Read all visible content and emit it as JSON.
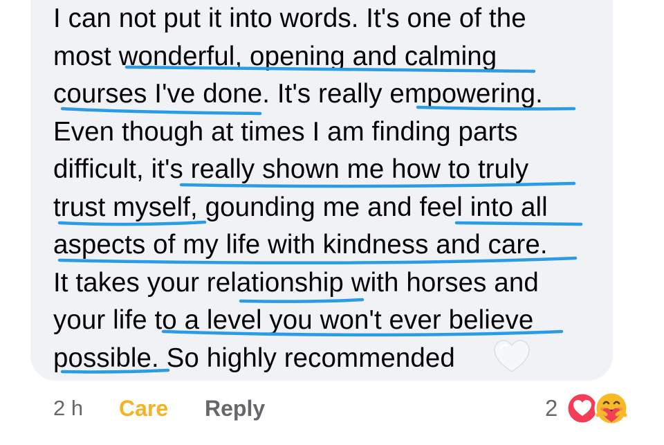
{
  "comment": {
    "lines": [
      "I can not put it into words. It's one of the",
      "most wonderful, opening and calming",
      "courses I've done. It's really empowering.",
      "Even though at times I am finding parts",
      "difficult, it's really shown me how to truly",
      "trust myself, gounding me and feel into all",
      "aspects of my life with kindness and care.",
      "It takes your relationship with horses and",
      "your life to a level you won't ever believe",
      "possible. So highly recommended"
    ],
    "end_emoji_icon": "white-heart-icon"
  },
  "actions": {
    "time": "2 h",
    "care_label": "Care",
    "reply_label": "Reply"
  },
  "reactions": {
    "count": "2",
    "icons": [
      "love-reaction-icon",
      "care-reaction-icon"
    ]
  },
  "colors": {
    "bubble": "#f0f2f5",
    "text": "#050505",
    "meta": "#65676b",
    "care": "#f7b125",
    "underline": "#2a9be4"
  }
}
